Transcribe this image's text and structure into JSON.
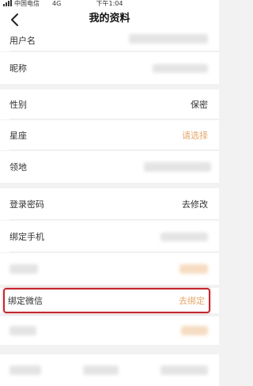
{
  "status_bar": {
    "carrier": "中国电信",
    "network": "4G",
    "time": "下午1:04"
  },
  "nav": {
    "title": "我的资料"
  },
  "rows": [
    {
      "label": "用户名",
      "value": ""
    },
    {
      "label": "昵称",
      "value": ""
    },
    {
      "label": "性别",
      "value": "保密"
    },
    {
      "label": "星座",
      "value": "请选择"
    },
    {
      "label": "领地",
      "value": ""
    },
    {
      "label": "登录密码",
      "value": "去修改"
    },
    {
      "label": "绑定手机",
      "value": ""
    },
    {
      "label": "",
      "value": ""
    },
    {
      "label": "绑定微信",
      "value": "去绑定"
    }
  ],
  "colors": {
    "accent": "#e5a76a",
    "highlight": "#c4262e"
  },
  "icons": {
    "back": "chevron-left-icon"
  }
}
